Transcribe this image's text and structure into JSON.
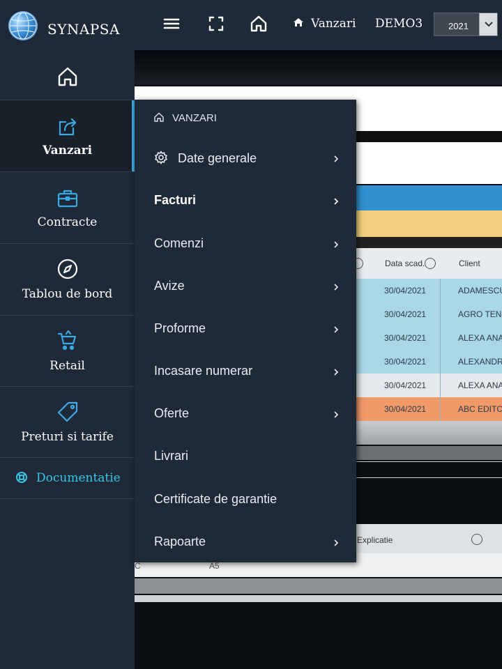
{
  "header": {
    "app_name": "SYNAPSA",
    "breadcrumb_label": "Vanzari",
    "company": "DEMO3",
    "year": "2021",
    "icons": [
      "menu-icon",
      "fullscreen-icon",
      "home-icon"
    ]
  },
  "sidebar": {
    "items": [
      {
        "icon": "home-icon",
        "label": ""
      },
      {
        "icon": "share-icon",
        "label": "Vanzari",
        "active": true
      },
      {
        "icon": "briefcase-icon",
        "label": "Contracte"
      },
      {
        "icon": "compass-icon",
        "label": "Tablou de bord"
      },
      {
        "icon": "cart-icon",
        "label": "Retail"
      },
      {
        "icon": "tag-icon",
        "label": "Preturi si tarife"
      }
    ],
    "doc_link": {
      "icon": "lifebuoy-icon",
      "label": "Documentatie"
    }
  },
  "flyout": {
    "heading": "VANZARI",
    "items": [
      {
        "label": "Date generale",
        "icon": "gear-icon",
        "has_submenu": true
      },
      {
        "label": "Facturi",
        "bold": true,
        "has_submenu": true
      },
      {
        "label": "Comenzi",
        "has_submenu": true
      },
      {
        "label": "Avize",
        "has_submenu": true
      },
      {
        "label": "Proforme",
        "has_submenu": true
      },
      {
        "label": "Incasare numerar",
        "has_submenu": true
      },
      {
        "label": "Oferte",
        "has_submenu": true
      },
      {
        "label": "Livrari",
        "has_submenu": false
      },
      {
        "label": "Certificate de garantie",
        "has_submenu": false
      },
      {
        "label": "Rapoarte",
        "has_submenu": true
      }
    ]
  },
  "background_grid": {
    "columns": [
      "Data scad.",
      "Client"
    ],
    "rows": [
      {
        "date": "30/04/2021",
        "client": "ADAMESCU"
      },
      {
        "date": "30/04/2021",
        "client": "AGRO TEN"
      },
      {
        "date": "30/04/2021",
        "client": "ALEXA ANA"
      },
      {
        "date": "30/04/2021",
        "client": "ALEXANDR"
      },
      {
        "date": "30/04/2021",
        "client": "ALEXA ANA"
      },
      {
        "date": "30/04/2021",
        "client": "ABC EDITC"
      }
    ],
    "lower_column": "Explicatie",
    "lower_cells": [
      "C",
      "A5"
    ]
  },
  "colors": {
    "panel": "#1e2a38",
    "accent": "#3da9e3",
    "doc_link": "#37c7e8",
    "row_blue": "#a9d7e6",
    "row_white": "#e6e9ec",
    "row_orange": "#f09a6a",
    "band_yellow": "#f2cf7e"
  }
}
